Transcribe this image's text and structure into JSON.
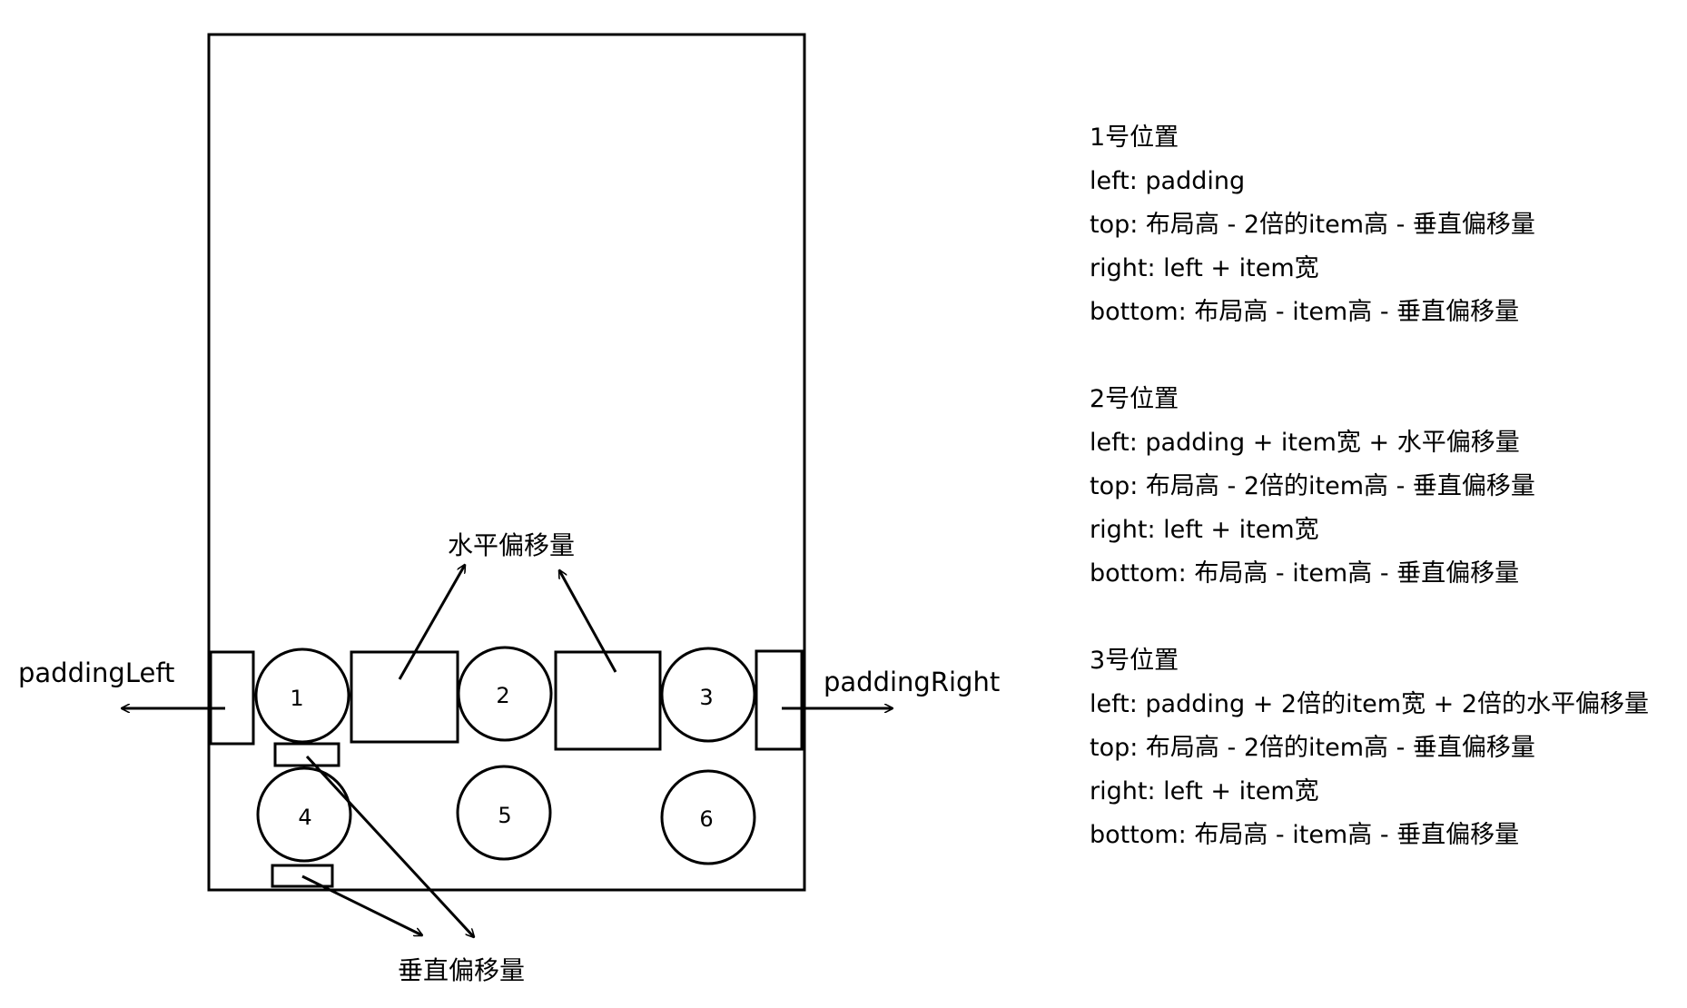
{
  "diagram": {
    "circles": [
      {
        "id": "1",
        "label": "1"
      },
      {
        "id": "2",
        "label": "2"
      },
      {
        "id": "3",
        "label": "3"
      },
      {
        "id": "4",
        "label": "4"
      },
      {
        "id": "5",
        "label": "5"
      },
      {
        "id": "6",
        "label": "6"
      }
    ],
    "labels": {
      "padding_left": "paddingLeft",
      "padding_right": "paddingRight",
      "horizontal_offset": "水平偏移量",
      "vertical_offset": "垂直偏移量"
    }
  },
  "positions": [
    {
      "title": "1号位置",
      "left": "left: padding",
      "top": "top: 布局高 - 2倍的item高 - 垂直偏移量",
      "right": "right: left + item宽",
      "bottom": "bottom: 布局高 - item高 - 垂直偏移量"
    },
    {
      "title": "2号位置",
      "left": "left: padding + item宽 + 水平偏移量",
      "top": "top: 布局高 - 2倍的item高 - 垂直偏移量",
      "right": "right: left + item宽",
      "bottom": "bottom: 布局高 - item高 - 垂直偏移量"
    },
    {
      "title": "3号位置",
      "left": "left: padding + 2倍的item宽 + 2倍的水平偏移量",
      "top": "top: 布局高 - 2倍的item高 - 垂直偏移量",
      "right": "right: left + item宽",
      "bottom": "bottom: 布局高 - item高 - 垂直偏移量"
    }
  ]
}
